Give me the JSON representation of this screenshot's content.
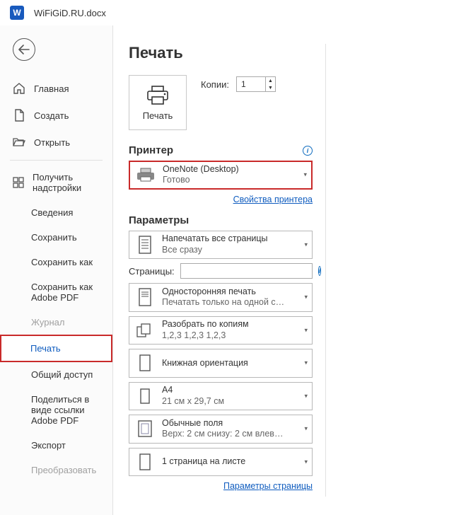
{
  "titlebar": {
    "app_letter": "W",
    "doc": "WiFiGiD.RU.docx"
  },
  "sidebar": {
    "home": "Главная",
    "new": "Создать",
    "open": "Открыть",
    "addins": "Получить надстройки",
    "info": "Сведения",
    "save": "Сохранить",
    "saveas": "Сохранить как",
    "saveas_pdf": "Сохранить как Adobe PDF",
    "history": "Журнал",
    "print": "Печать",
    "share": "Общий доступ",
    "share_link_pdf": "Поделиться в виде ссылки Adobe PDF",
    "export": "Экспорт",
    "transform": "Преобразовать"
  },
  "main": {
    "heading": "Печать",
    "print_btn": "Печать",
    "copies_label": "Копии:",
    "copies_value": "1",
    "printer_section": "Принтер",
    "printer": {
      "name": "OneNote (Desktop)",
      "status": "Готово"
    },
    "printer_props": "Свойства принтера",
    "params_section": "Параметры",
    "pages_label": "Страницы:",
    "params": {
      "what": {
        "title": "Напечатать все страницы",
        "sub": "Все сразу"
      },
      "sides": {
        "title": "Односторонняя печать",
        "sub": "Печатать только на одной с…"
      },
      "collate": {
        "title": "Разобрать по копиям",
        "sub": "1,2,3    1,2,3    1,2,3"
      },
      "orient": {
        "title": "Книжная ориентация",
        "sub": ""
      },
      "size": {
        "title": "A4",
        "sub": "21 см x 29,7 см"
      },
      "margins": {
        "title": "Обычные поля",
        "sub": "Верх: 2 см снизу: 2 см влев…"
      },
      "perpage": {
        "title": "1 страница на листе",
        "sub": ""
      }
    },
    "page_setup": "Параметры страницы"
  }
}
